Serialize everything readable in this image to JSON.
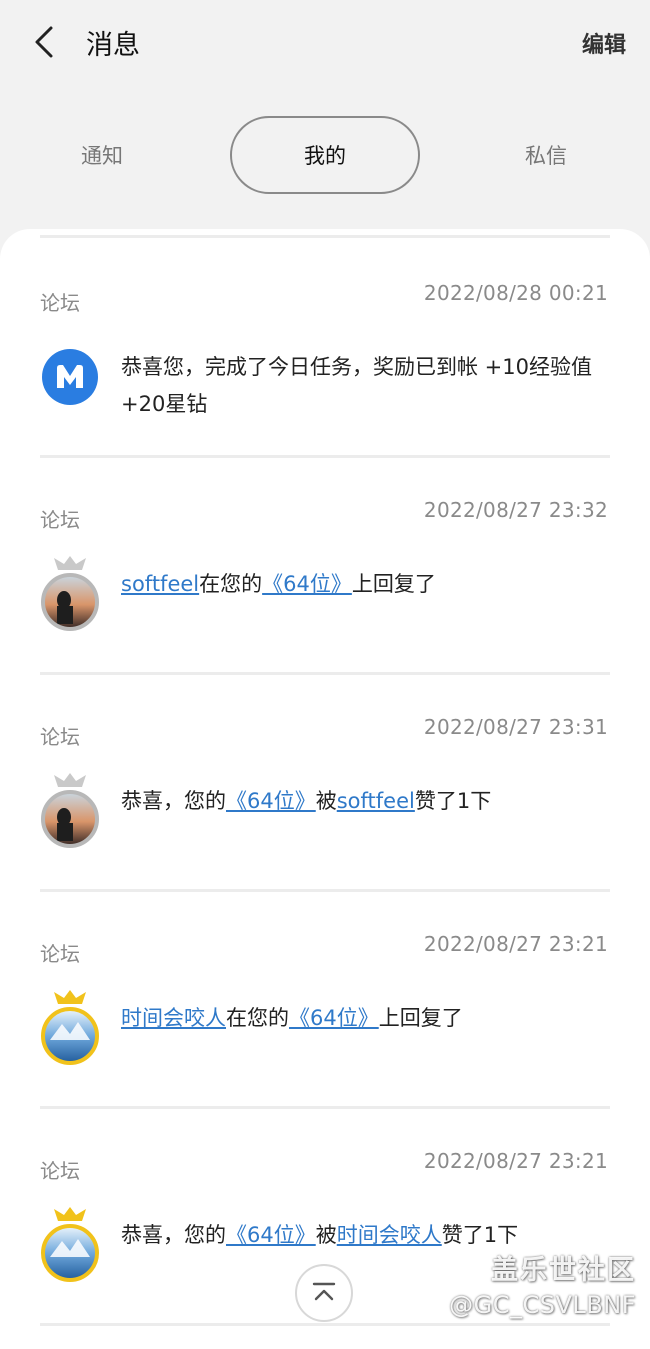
{
  "header": {
    "title": "消息",
    "edit_label": "编辑"
  },
  "tabs": [
    {
      "label": "通知",
      "active": false
    },
    {
      "label": "我的",
      "active": true
    },
    {
      "label": "私信",
      "active": false
    }
  ],
  "messages": [
    {
      "source": "论坛",
      "time": "2022/08/28 00:21",
      "avatar": "m-logo-icon",
      "parts": [
        {
          "text": "恭喜您，完成了今日任务，奖励已到帐 +10经验值 +20星钻",
          "link": false
        }
      ]
    },
    {
      "source": "论坛",
      "time": "2022/08/27 23:32",
      "avatar": "silver-crown-avatar",
      "parts": [
        {
          "text": "softfeel",
          "link": true
        },
        {
          "text": "在您的",
          "link": false
        },
        {
          "text": "《64位》",
          "link": true
        },
        {
          "text": "上回复了",
          "link": false
        }
      ]
    },
    {
      "source": "论坛",
      "time": "2022/08/27 23:31",
      "avatar": "silver-crown-avatar",
      "parts": [
        {
          "text": "恭喜，您的",
          "link": false
        },
        {
          "text": "《64位》",
          "link": true
        },
        {
          "text": "被",
          "link": false
        },
        {
          "text": "softfeel",
          "link": true
        },
        {
          "text": "赞了1下",
          "link": false
        }
      ]
    },
    {
      "source": "论坛",
      "time": "2022/08/27 23:21",
      "avatar": "gold-crown-avatar",
      "parts": [
        {
          "text": "时间会咬人",
          "link": true
        },
        {
          "text": "在您的",
          "link": false
        },
        {
          "text": "《64位》",
          "link": true
        },
        {
          "text": "上回复了",
          "link": false
        }
      ]
    },
    {
      "source": "论坛",
      "time": "2022/08/27 23:21",
      "avatar": "gold-crown-avatar",
      "parts": [
        {
          "text": "恭喜，您的",
          "link": false
        },
        {
          "text": "《64位》",
          "link": true
        },
        {
          "text": "被",
          "link": false
        },
        {
          "text": "时间会咬人",
          "link": true
        },
        {
          "text": "赞了1下",
          "link": false
        }
      ]
    }
  ],
  "scroll_top": {
    "icon": "chevron-up-to-top-icon"
  },
  "watermark": {
    "line1": "盖乐世社区",
    "line2": "@GC_CSVLBNF"
  },
  "colors": {
    "link": "#2f79c9",
    "brand_blue": "#2a7de1",
    "background": "#f2f2f2",
    "gold": "#f1c21b",
    "silver": "#b8b8b8"
  }
}
